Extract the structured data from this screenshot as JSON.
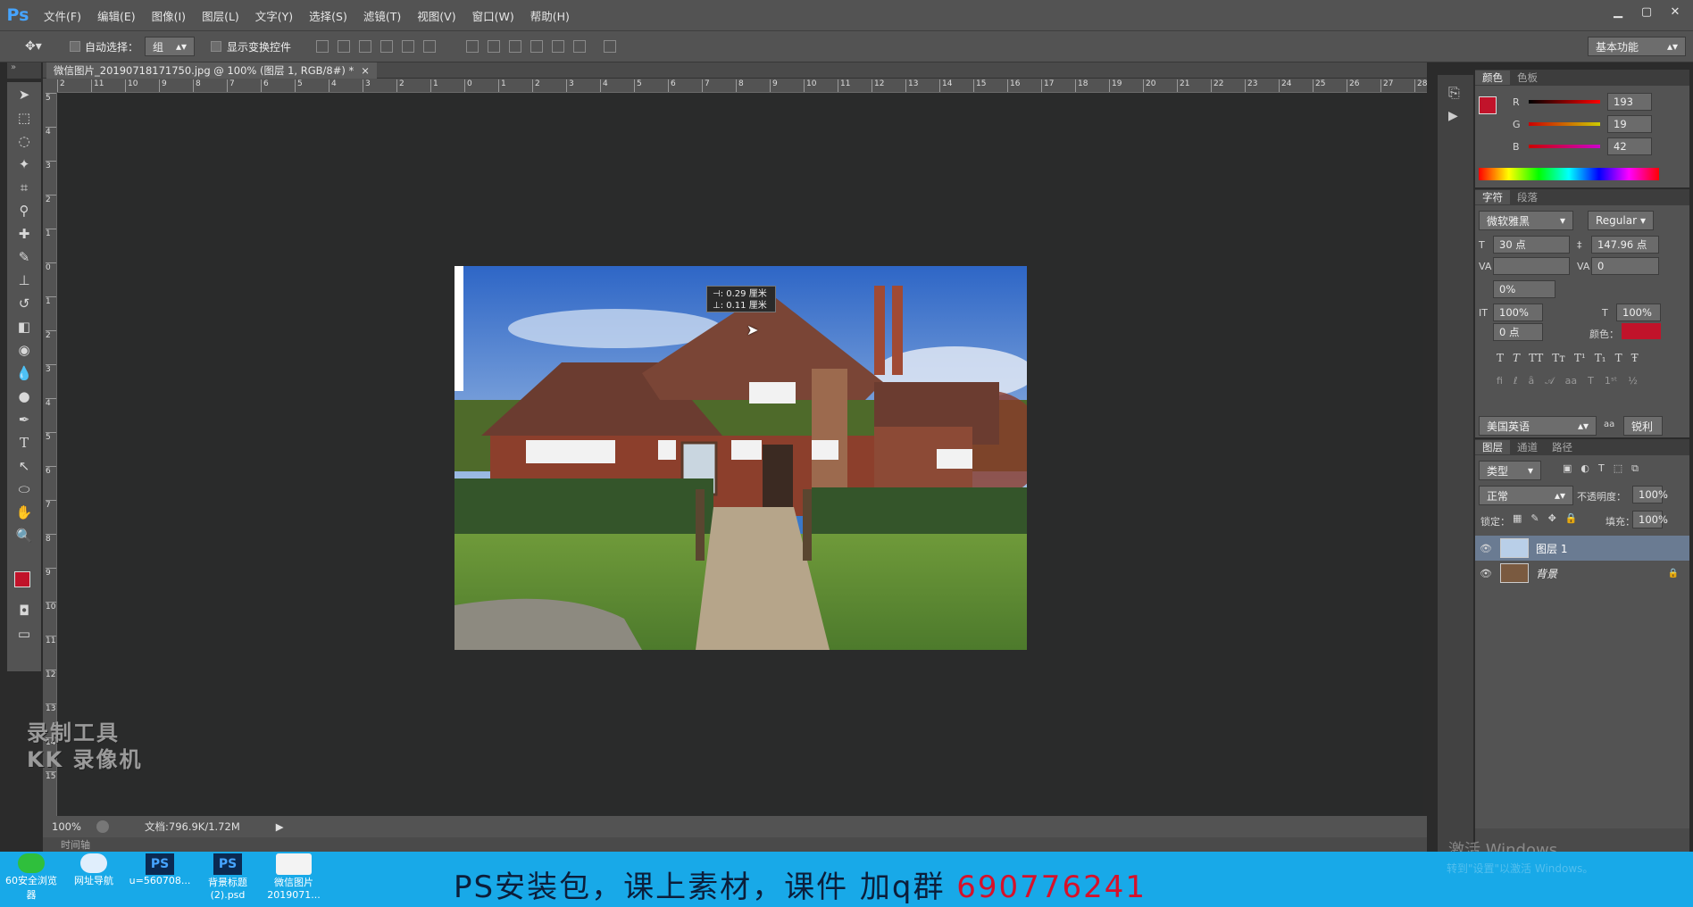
{
  "app": {
    "logo": "Ps"
  },
  "menu": [
    "文件(F)",
    "编辑(E)",
    "图像(I)",
    "图层(L)",
    "文字(Y)",
    "选择(S)",
    "滤镜(T)",
    "视图(V)",
    "窗口(W)",
    "帮助(H)"
  ],
  "options": {
    "auto_select_label": "自动选择：",
    "auto_select_value": "组",
    "show_transform_label": "显示变换控件",
    "workspace": "基本功能"
  },
  "document": {
    "tab_title": "微信图片_20190718171750.jpg @ 100% (图层 1, RGB/8#) *",
    "measure_x": "0.29 厘米",
    "measure_y": "0.11 厘米",
    "hruler_ticks": [
      "2",
      "11",
      "10",
      "9",
      "8",
      "7",
      "6",
      "5",
      "4",
      "3",
      "2",
      "1",
      "0",
      "1",
      "2",
      "3",
      "4",
      "5",
      "6",
      "7",
      "8",
      "9",
      "10",
      "11",
      "12",
      "13",
      "14",
      "15",
      "16",
      "17",
      "18",
      "19",
      "20",
      "21",
      "22",
      "23",
      "24",
      "25",
      "26",
      "27",
      "28"
    ],
    "vruler_ticks": [
      "5",
      "4",
      "3",
      "2",
      "1",
      "0",
      "1",
      "2",
      "3",
      "4",
      "5",
      "6",
      "7",
      "8",
      "9",
      "10",
      "11",
      "12",
      "13",
      "14",
      "15"
    ]
  },
  "status": {
    "zoom": "100%",
    "doc_size": "文档:796.9K/1.72M",
    "timeline": "时间轴"
  },
  "color_panel": {
    "tabs": [
      "颜色",
      "色板"
    ],
    "fg_color": "#c1132a",
    "r_label": "R",
    "r": "193",
    "g_label": "G",
    "g": "19",
    "b_label": "B",
    "b": "42"
  },
  "char_panel": {
    "tabs": [
      "字符",
      "段落"
    ],
    "font": "微软雅黑",
    "style": "Regular",
    "size": "30 点",
    "leading": "147.96 点",
    "tracking": "0",
    "scale": "0%",
    "v_scale": "100%",
    "h_scale": "100%",
    "baseline": "0 点",
    "color_label": "颜色：",
    "text_color": "#c1132a",
    "language": "美国英语",
    "aa_label": "aa",
    "aa": "锐利"
  },
  "layers_panel": {
    "tabs": [
      "图层",
      "通道",
      "路径"
    ],
    "kind": "类型",
    "blend": "正常",
    "opacity_label": "不透明度：",
    "opacity": "100%",
    "lock_label": "锁定：",
    "fill_label": "填充：",
    "fill": "100%",
    "layers": [
      {
        "name": "图层 1"
      },
      {
        "name": "背景"
      }
    ]
  },
  "overlays": {
    "watermark_line1": "录制工具",
    "watermark_line2": "KK 录像机",
    "activate_windows": "激活 Windows",
    "activate_sub": "转到\"设置\"以激活 Windows。"
  },
  "taskbar": {
    "items": [
      {
        "label1": "60安全浏览",
        "label2": "器"
      },
      {
        "label1": "网址导航",
        "label2": ""
      },
      {
        "label1": "u=560708...",
        "label2": ""
      },
      {
        "label1": "背景标题",
        "label2": "(2).psd"
      },
      {
        "label1": "微信图片",
        "label2": "2019071..."
      }
    ],
    "promo_text": "PS安装包，课上素材，课件 加q群 ",
    "promo_number": "690776241"
  }
}
